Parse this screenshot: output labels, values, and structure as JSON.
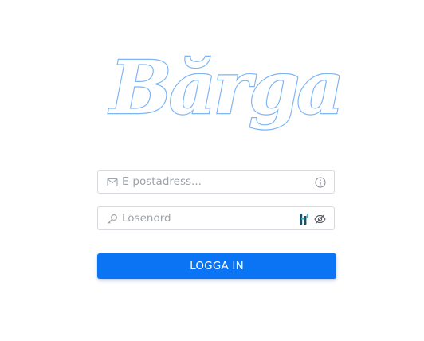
{
  "logo": {
    "text": "Bărgain",
    "outline_color": "#7db5f5"
  },
  "form": {
    "email": {
      "value": "",
      "placeholder": "E-postadress...",
      "lead_icon": "mail-icon",
      "trail_icon": "info-icon"
    },
    "password": {
      "value": "",
      "placeholder": "Lösenord",
      "lead_icon": "key-icon",
      "trail_icons": [
        "password-manager-icon",
        "eye-slash-icon"
      ]
    },
    "submit_label": "LOGGA IN"
  },
  "colors": {
    "accent": "#0a74f5",
    "border": "#d6d9de",
    "placeholder": "#9ea3a9",
    "background": "#ffffff"
  }
}
